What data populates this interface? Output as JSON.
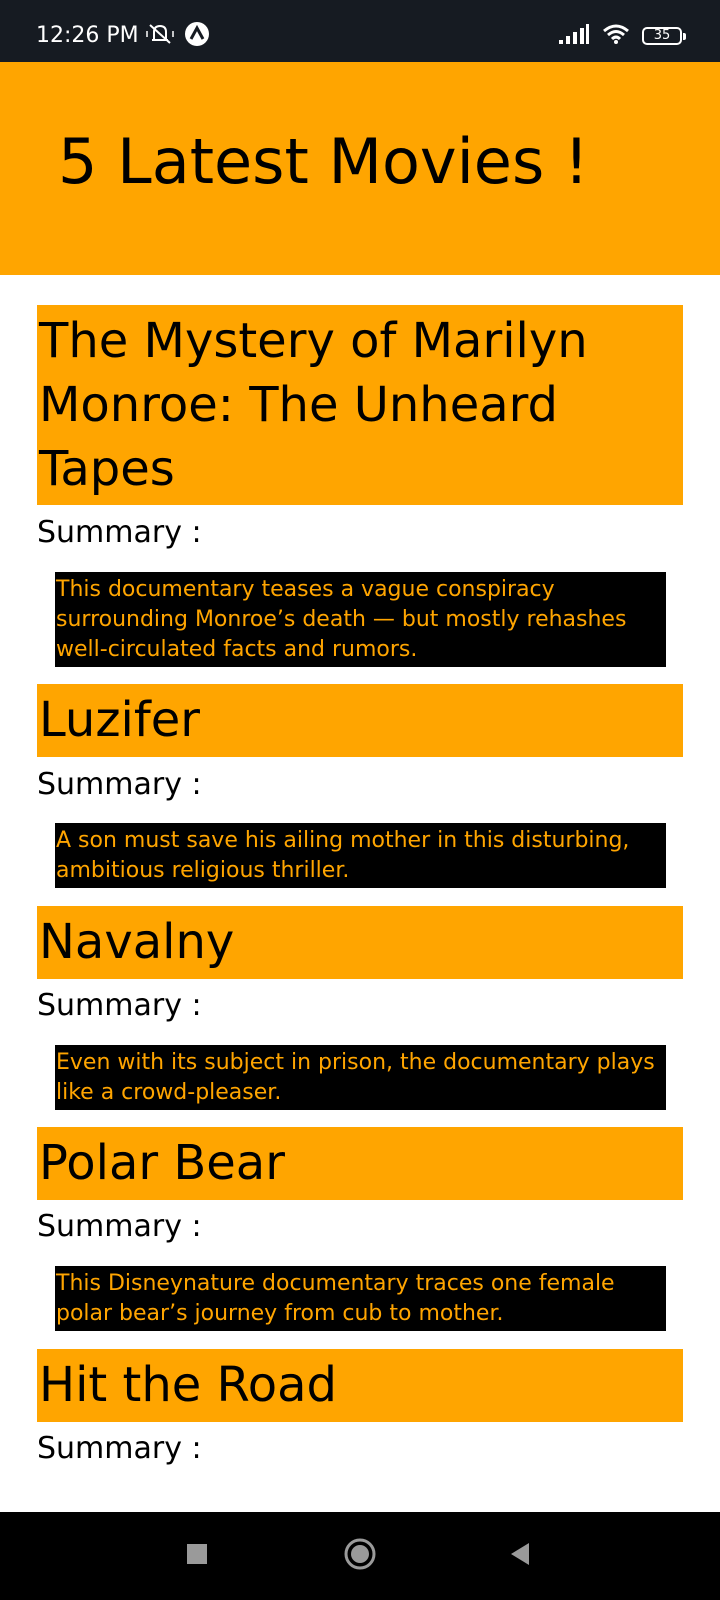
{
  "status_bar": {
    "time": "12:26 PM",
    "battery": "35",
    "icons": [
      "mute-notification-icon",
      "app-badge-icon",
      "signal-icon",
      "wifi-icon",
      "battery-icon"
    ]
  },
  "header": {
    "title": "5 Latest Movies !"
  },
  "movies": [
    {
      "title": "The Mystery of Marilyn Monroe: The Unheard Tapes",
      "summary_label": "Summary :",
      "summary": "This documentary teases a vague conspiracy surrounding Monroe’s death — but mostly rehashes well-circulated facts and rumors."
    },
    {
      "title": "Luzifer",
      "summary_label": "Summary :",
      "summary": "A son must save his ailing mother in this disturbing, ambitious religious thriller."
    },
    {
      "title": "Navalny",
      "summary_label": "Summary :",
      "summary": "Even with its subject in prison, the documentary plays like a crowd-pleaser."
    },
    {
      "title": "Polar Bear",
      "summary_label": "Summary :",
      "summary": "This Disneynature documentary traces one female polar bear’s journey from cub to mother."
    },
    {
      "title": "Hit the Road",
      "summary_label": "Summary :"
    }
  ],
  "nav_bar": {
    "buttons": [
      "recents-square-icon",
      "home-circle-icon",
      "back-triangle-icon"
    ]
  },
  "colors": {
    "accent": "#ffa500",
    "status_bar": "#161b22",
    "summary_bg": "#000000",
    "nav_bar": "#000000"
  }
}
